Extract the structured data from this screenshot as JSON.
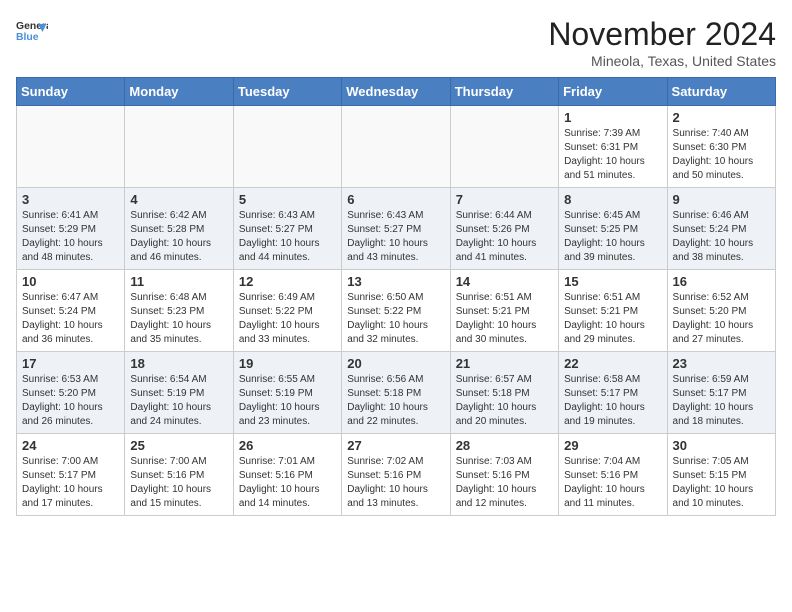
{
  "header": {
    "logo_line1": "General",
    "logo_line2": "Blue",
    "month": "November 2024",
    "location": "Mineola, Texas, United States"
  },
  "weekdays": [
    "Sunday",
    "Monday",
    "Tuesday",
    "Wednesday",
    "Thursday",
    "Friday",
    "Saturday"
  ],
  "weeks": [
    [
      {
        "day": "",
        "info": ""
      },
      {
        "day": "",
        "info": ""
      },
      {
        "day": "",
        "info": ""
      },
      {
        "day": "",
        "info": ""
      },
      {
        "day": "",
        "info": ""
      },
      {
        "day": "1",
        "info": "Sunrise: 7:39 AM\nSunset: 6:31 PM\nDaylight: 10 hours\nand 51 minutes."
      },
      {
        "day": "2",
        "info": "Sunrise: 7:40 AM\nSunset: 6:30 PM\nDaylight: 10 hours\nand 50 minutes."
      }
    ],
    [
      {
        "day": "3",
        "info": "Sunrise: 6:41 AM\nSunset: 5:29 PM\nDaylight: 10 hours\nand 48 minutes."
      },
      {
        "day": "4",
        "info": "Sunrise: 6:42 AM\nSunset: 5:28 PM\nDaylight: 10 hours\nand 46 minutes."
      },
      {
        "day": "5",
        "info": "Sunrise: 6:43 AM\nSunset: 5:27 PM\nDaylight: 10 hours\nand 44 minutes."
      },
      {
        "day": "6",
        "info": "Sunrise: 6:43 AM\nSunset: 5:27 PM\nDaylight: 10 hours\nand 43 minutes."
      },
      {
        "day": "7",
        "info": "Sunrise: 6:44 AM\nSunset: 5:26 PM\nDaylight: 10 hours\nand 41 minutes."
      },
      {
        "day": "8",
        "info": "Sunrise: 6:45 AM\nSunset: 5:25 PM\nDaylight: 10 hours\nand 39 minutes."
      },
      {
        "day": "9",
        "info": "Sunrise: 6:46 AM\nSunset: 5:24 PM\nDaylight: 10 hours\nand 38 minutes."
      }
    ],
    [
      {
        "day": "10",
        "info": "Sunrise: 6:47 AM\nSunset: 5:24 PM\nDaylight: 10 hours\nand 36 minutes."
      },
      {
        "day": "11",
        "info": "Sunrise: 6:48 AM\nSunset: 5:23 PM\nDaylight: 10 hours\nand 35 minutes."
      },
      {
        "day": "12",
        "info": "Sunrise: 6:49 AM\nSunset: 5:22 PM\nDaylight: 10 hours\nand 33 minutes."
      },
      {
        "day": "13",
        "info": "Sunrise: 6:50 AM\nSunset: 5:22 PM\nDaylight: 10 hours\nand 32 minutes."
      },
      {
        "day": "14",
        "info": "Sunrise: 6:51 AM\nSunset: 5:21 PM\nDaylight: 10 hours\nand 30 minutes."
      },
      {
        "day": "15",
        "info": "Sunrise: 6:51 AM\nSunset: 5:21 PM\nDaylight: 10 hours\nand 29 minutes."
      },
      {
        "day": "16",
        "info": "Sunrise: 6:52 AM\nSunset: 5:20 PM\nDaylight: 10 hours\nand 27 minutes."
      }
    ],
    [
      {
        "day": "17",
        "info": "Sunrise: 6:53 AM\nSunset: 5:20 PM\nDaylight: 10 hours\nand 26 minutes."
      },
      {
        "day": "18",
        "info": "Sunrise: 6:54 AM\nSunset: 5:19 PM\nDaylight: 10 hours\nand 24 minutes."
      },
      {
        "day": "19",
        "info": "Sunrise: 6:55 AM\nSunset: 5:19 PM\nDaylight: 10 hours\nand 23 minutes."
      },
      {
        "day": "20",
        "info": "Sunrise: 6:56 AM\nSunset: 5:18 PM\nDaylight: 10 hours\nand 22 minutes."
      },
      {
        "day": "21",
        "info": "Sunrise: 6:57 AM\nSunset: 5:18 PM\nDaylight: 10 hours\nand 20 minutes."
      },
      {
        "day": "22",
        "info": "Sunrise: 6:58 AM\nSunset: 5:17 PM\nDaylight: 10 hours\nand 19 minutes."
      },
      {
        "day": "23",
        "info": "Sunrise: 6:59 AM\nSunset: 5:17 PM\nDaylight: 10 hours\nand 18 minutes."
      }
    ],
    [
      {
        "day": "24",
        "info": "Sunrise: 7:00 AM\nSunset: 5:17 PM\nDaylight: 10 hours\nand 17 minutes."
      },
      {
        "day": "25",
        "info": "Sunrise: 7:00 AM\nSunset: 5:16 PM\nDaylight: 10 hours\nand 15 minutes."
      },
      {
        "day": "26",
        "info": "Sunrise: 7:01 AM\nSunset: 5:16 PM\nDaylight: 10 hours\nand 14 minutes."
      },
      {
        "day": "27",
        "info": "Sunrise: 7:02 AM\nSunset: 5:16 PM\nDaylight: 10 hours\nand 13 minutes."
      },
      {
        "day": "28",
        "info": "Sunrise: 7:03 AM\nSunset: 5:16 PM\nDaylight: 10 hours\nand 12 minutes."
      },
      {
        "day": "29",
        "info": "Sunrise: 7:04 AM\nSunset: 5:16 PM\nDaylight: 10 hours\nand 11 minutes."
      },
      {
        "day": "30",
        "info": "Sunrise: 7:05 AM\nSunset: 5:15 PM\nDaylight: 10 hours\nand 10 minutes."
      }
    ]
  ]
}
